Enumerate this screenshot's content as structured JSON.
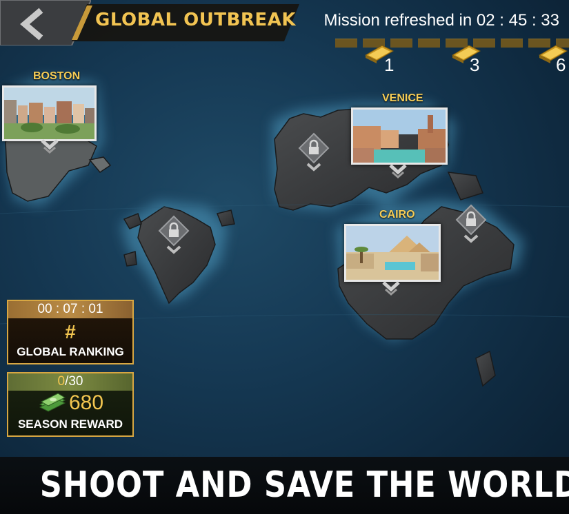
{
  "header": {
    "back_icon": "chevron-left-icon",
    "title": "GLOBAL OUTBREAK",
    "mission_refresh": "Mission refreshed in 02 : 45 : 33",
    "gold_rewards": [
      {
        "icon": "gold-bar-icon",
        "count": "1"
      },
      {
        "icon": "gold-bar-icon",
        "count": "3"
      },
      {
        "icon": "gold-bar-icon",
        "count": "6"
      }
    ]
  },
  "cities": {
    "boston": {
      "label": "BOSTON",
      "locked": false
    },
    "venice": {
      "label": "VENICE",
      "locked": false
    },
    "cairo": {
      "label": "CAIRO",
      "locked": false
    }
  },
  "locks": {
    "icon": "padlock-icon",
    "count": 3
  },
  "ranking": {
    "timer": "00 : 07 : 01",
    "value": "#",
    "label": "GLOBAL RANKING"
  },
  "season": {
    "current": "0",
    "total": "/30",
    "amount": "680",
    "icon": "cash-stack-icon",
    "label": "SEASON REWARD"
  },
  "banner": {
    "text": "SHOOT AND SAVE THE WORLD!"
  },
  "colors": {
    "gold": "#f2c452",
    "panel_border": "#d8a742",
    "ocean": "#163a55",
    "land": "#3a3c3e"
  }
}
